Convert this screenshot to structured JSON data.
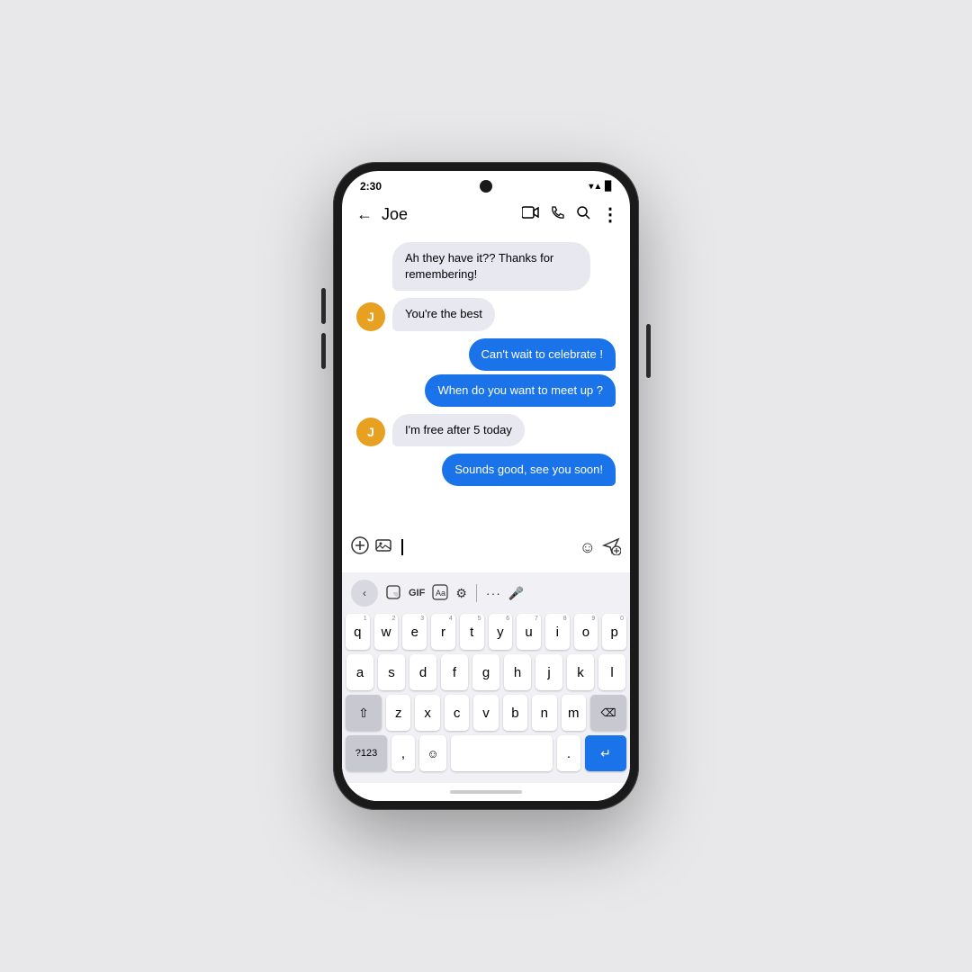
{
  "statusBar": {
    "time": "2:30",
    "icons": "▾▲▉"
  },
  "appBar": {
    "backLabel": "←",
    "contactName": "Joe",
    "videoIcon": "⬜",
    "phoneIcon": "✆",
    "searchIcon": "🔍",
    "moreIcon": "⋮"
  },
  "messages": [
    {
      "id": 1,
      "type": "received",
      "text": "Ah they have it?? Thanks for remembering!",
      "showAvatar": false
    },
    {
      "id": 2,
      "type": "received",
      "text": "You're the best",
      "showAvatar": true
    },
    {
      "id": 3,
      "type": "sent",
      "text": "Can't wait to celebrate !"
    },
    {
      "id": 4,
      "type": "sent",
      "text": "When do you want to meet up ?"
    },
    {
      "id": 5,
      "type": "received",
      "text": "I'm free after 5 today",
      "showAvatar": true
    },
    {
      "id": 6,
      "type": "sent",
      "text": "Sounds good, see you soon!"
    }
  ],
  "inputArea": {
    "addIcon": "⊕",
    "mediaIcon": "🖼",
    "emojiIcon": "☺",
    "sendIcon": "➤",
    "placeholder": ""
  },
  "keyboard": {
    "toolbar": {
      "backIcon": "‹",
      "stickerIcon": "⊡",
      "gifLabel": "GIF",
      "translateIcon": "⊞",
      "settingsIcon": "⚙",
      "moreIcon": "···",
      "micIcon": "🎤"
    },
    "rows": [
      [
        "q",
        "w",
        "e",
        "r",
        "t",
        "y",
        "u",
        "i",
        "o",
        "p"
      ],
      [
        "a",
        "s",
        "d",
        "f",
        "g",
        "h",
        "j",
        "k",
        "l"
      ],
      [
        "⇧",
        "z",
        "x",
        "c",
        "v",
        "b",
        "n",
        "m",
        "⌫"
      ],
      [
        "?123",
        ",",
        "☺",
        " ",
        ".",
        "↵"
      ]
    ],
    "numHints": [
      "1",
      "2",
      "3",
      "4",
      "5",
      "6",
      "7",
      "8",
      "9",
      "0"
    ]
  },
  "avatar": {
    "letter": "J",
    "color": "#E8A020"
  }
}
